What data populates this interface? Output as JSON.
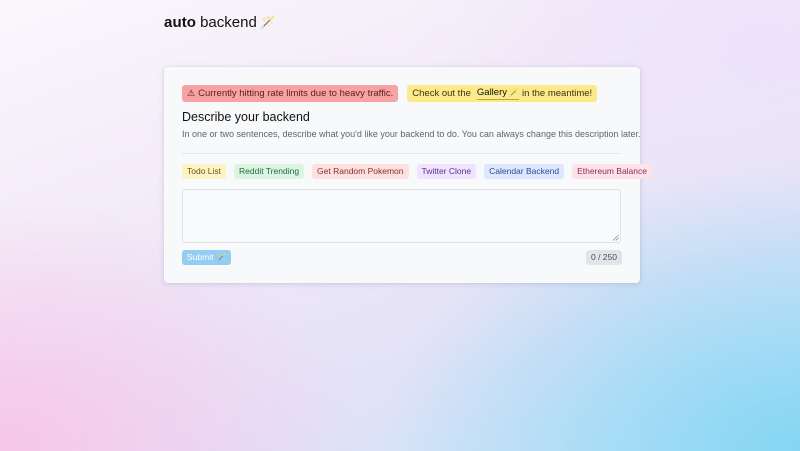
{
  "brand": {
    "bold": "auto",
    "regular": "backend",
    "icon": "magic-wand-icon"
  },
  "notice": {
    "warning_icon": "⚠",
    "warning_text": "Currently hitting rate limits due to heavy traffic.",
    "gallery_prefix": "Check out the",
    "gallery_link": "Gallery",
    "gallery_suffix": "in the meantime!",
    "colors": {
      "warning_bg": "#f7a3a3",
      "gallery_bg": "#fbe98a"
    }
  },
  "form": {
    "title": "Describe your backend",
    "subtitle": "In one or two sentences, describe what you'd like your backend to do. You can always change this description later.",
    "examples": [
      "Todo List",
      "Reddit Trending",
      "Get Random Pokemon",
      "Twitter Clone",
      "Calendar Backend",
      "Ethereum Balance"
    ],
    "description_value": "",
    "submit_label": "Submit",
    "char_count": "0 / 250",
    "colors": {
      "submit_bg": "#93cdf2"
    }
  }
}
